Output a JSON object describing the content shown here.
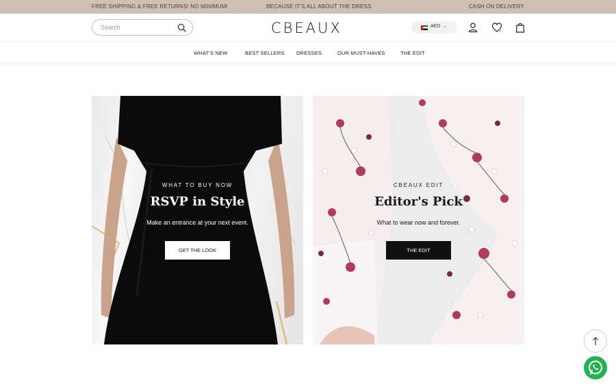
{
  "topbar": {
    "left": "FREE SHIPPING & FREE RETURNS! NO MINIMUM!",
    "center": "BECAUSE IT'S ALL ABOUT THE DRESS",
    "right": "CASH ON DELIVERY"
  },
  "header": {
    "search_placeholder": "Search",
    "logo": "CBEAUX",
    "currency": "AED",
    "wishlist_count": "0"
  },
  "nav": {
    "items": [
      {
        "label": "WHAT'S NEW"
      },
      {
        "label": "BEST SELLERS"
      },
      {
        "label": "DRESSES"
      },
      {
        "label": "OUR MUST-HAVES"
      },
      {
        "label": "THE EDIT"
      }
    ]
  },
  "promos": [
    {
      "kicker": "WHAT TO BUY NOW",
      "title": "RSVP in Style",
      "subtitle": "Make an entrance at your next event.",
      "button": "GET THE LOOK"
    },
    {
      "kicker": "CBEAUX EDIT",
      "title": "Editor's Pick",
      "subtitle": "What to wear now and forever.",
      "button": "THE EDIT"
    }
  ],
  "colors": {
    "topbar_bg": "#cdc1b3",
    "whatsapp_green": "#22b14c",
    "dark_button": "#111111"
  },
  "icons": [
    "search-icon",
    "uae-flag-icon",
    "chevron-down-icon",
    "user-icon",
    "heart-icon",
    "shopping-bag-icon",
    "arrow-up-icon",
    "whatsapp-icon"
  ]
}
